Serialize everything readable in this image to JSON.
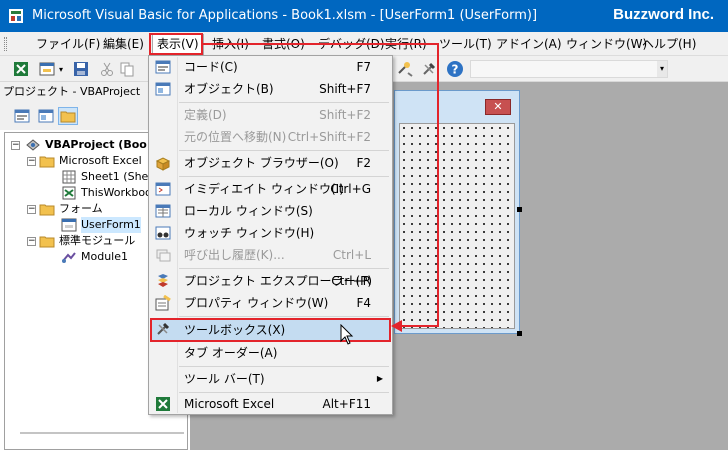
{
  "window": {
    "title": "Microsoft Visual Basic for Applications - Book1.xlsm - [UserForm1 (UserForm)]",
    "brand": "Buzzword Inc."
  },
  "menubar": {
    "items": [
      {
        "label": "ファイル(F)"
      },
      {
        "label": "編集(E)"
      },
      {
        "label": "表示(V)"
      },
      {
        "label": "挿入(I)"
      },
      {
        "label": "書式(O)"
      },
      {
        "label": "デバッグ(D)"
      },
      {
        "label": "実行(R)"
      },
      {
        "label": "ツール(T)"
      },
      {
        "label": "アドイン(A)"
      },
      {
        "label": "ウィンドウ(W)"
      },
      {
        "label": "ヘルプ(H)"
      }
    ]
  },
  "project_pane": {
    "title": "プロジェクト - VBAProject",
    "tree": [
      {
        "label": "VBAProject (Boo",
        "icon": "vba-project-icon"
      },
      {
        "label": "Microsoft Excel",
        "icon": "folder-icon"
      },
      {
        "label": "Sheet1 (Shee",
        "icon": "sheet-icon"
      },
      {
        "label": "ThisWorkboo",
        "icon": "workbook-icon"
      },
      {
        "label": "フォーム",
        "icon": "folder-icon"
      },
      {
        "label": "UserForm1",
        "icon": "userform-icon"
      },
      {
        "label": "標準モジュール",
        "icon": "folder-icon"
      },
      {
        "label": "Module1",
        "icon": "module-icon"
      }
    ]
  },
  "view_menu": {
    "items": [
      {
        "label": "コード(C)",
        "shortcut": "F7",
        "icon": "code-icon",
        "disabled": false
      },
      {
        "label": "オブジェクト(B)",
        "shortcut": "Shift+F7",
        "icon": "object-icon",
        "disabled": false
      },
      {
        "label": "定義(D)",
        "shortcut": "Shift+F2",
        "icon": "",
        "disabled": true
      },
      {
        "label": "元の位置へ移動(N)",
        "shortcut": "Ctrl+Shift+F2",
        "icon": "",
        "disabled": true
      },
      {
        "label": "オブジェクト ブラウザー(O)",
        "shortcut": "F2",
        "icon": "object-browser-icon",
        "disabled": false
      },
      {
        "label": "イミディエイト ウィンドウ(I)",
        "shortcut": "Ctrl+G",
        "icon": "immediate-window-icon",
        "disabled": false
      },
      {
        "label": "ローカル ウィンドウ(S)",
        "shortcut": "",
        "icon": "locals-window-icon",
        "disabled": false
      },
      {
        "label": "ウォッチ ウィンドウ(H)",
        "shortcut": "",
        "icon": "watch-window-icon",
        "disabled": false
      },
      {
        "label": "呼び出し履歴(K)...",
        "shortcut": "Ctrl+L",
        "icon": "call-stack-icon",
        "disabled": true
      },
      {
        "label": "プロジェクト エクスプローラー(P)",
        "shortcut": "Ctrl+R",
        "icon": "project-explorer-icon",
        "disabled": false
      },
      {
        "label": "プロパティ ウィンドウ(W)",
        "shortcut": "F4",
        "icon": "properties-window-icon",
        "disabled": false
      },
      {
        "label": "ツールボックス(X)",
        "shortcut": "",
        "icon": "toolbox-icon",
        "disabled": false
      },
      {
        "label": "タブ オーダー(A)",
        "shortcut": "",
        "icon": "",
        "disabled": false
      },
      {
        "label": "ツール バー(T)",
        "shortcut": "",
        "icon": "",
        "disabled": false
      },
      {
        "label": "Microsoft Excel",
        "shortcut": "Alt+F11",
        "icon": "excel-icon",
        "disabled": false
      }
    ]
  },
  "userform": {
    "close_glyph": "✕"
  },
  "colors": {
    "titlebar": "#0067c0",
    "annotation": "#e3242b",
    "highlight": "#c4dcf1"
  }
}
